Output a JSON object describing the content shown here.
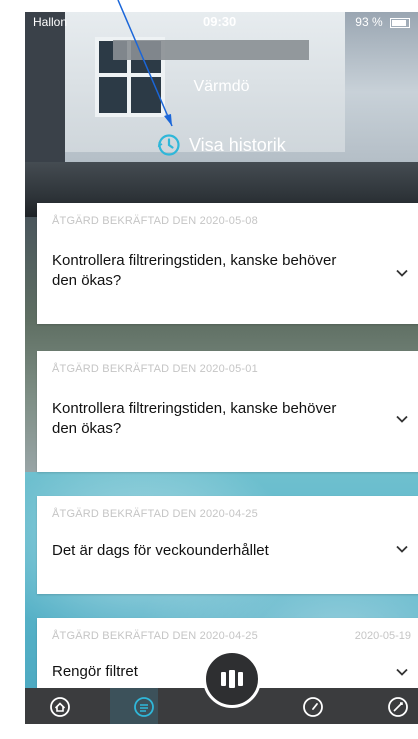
{
  "status": {
    "carrier": "Hallon",
    "time": "09:30",
    "battery": "93 %"
  },
  "header": {
    "location": "Värmdö",
    "history_label": "Visa historik"
  },
  "cards": [
    {
      "meta": "ÅTGÄRD BEKRÄFTAD DEN 2020-05-08",
      "meta_right": "",
      "title": "Kontrollera filtreringstiden, kanske behöver den ökas?"
    },
    {
      "meta": "ÅTGÄRD BEKRÄFTAD DEN 2020-05-01",
      "meta_right": "",
      "title": "Kontrollera filtreringstiden, kanske behöver den ökas?"
    },
    {
      "meta": "ÅTGÄRD BEKRÄFTAD DEN 2020-04-25",
      "meta_right": "",
      "title": "Det är dags för veckounderhållet"
    },
    {
      "meta": "ÅTGÄRD BEKRÄFTAD DEN 2020-04-25",
      "meta_right": "2020-05-19",
      "title": "Rengör filtret"
    }
  ],
  "colors": {
    "annotation_arrow": "#1a66d9",
    "navbar": "#3b3c3e",
    "card_meta": "#c5c5c5"
  },
  "nav": {
    "items": [
      "home-icon",
      "menu-icon",
      "pool-icon",
      "gauge-icon",
      "settings-icon"
    ]
  }
}
